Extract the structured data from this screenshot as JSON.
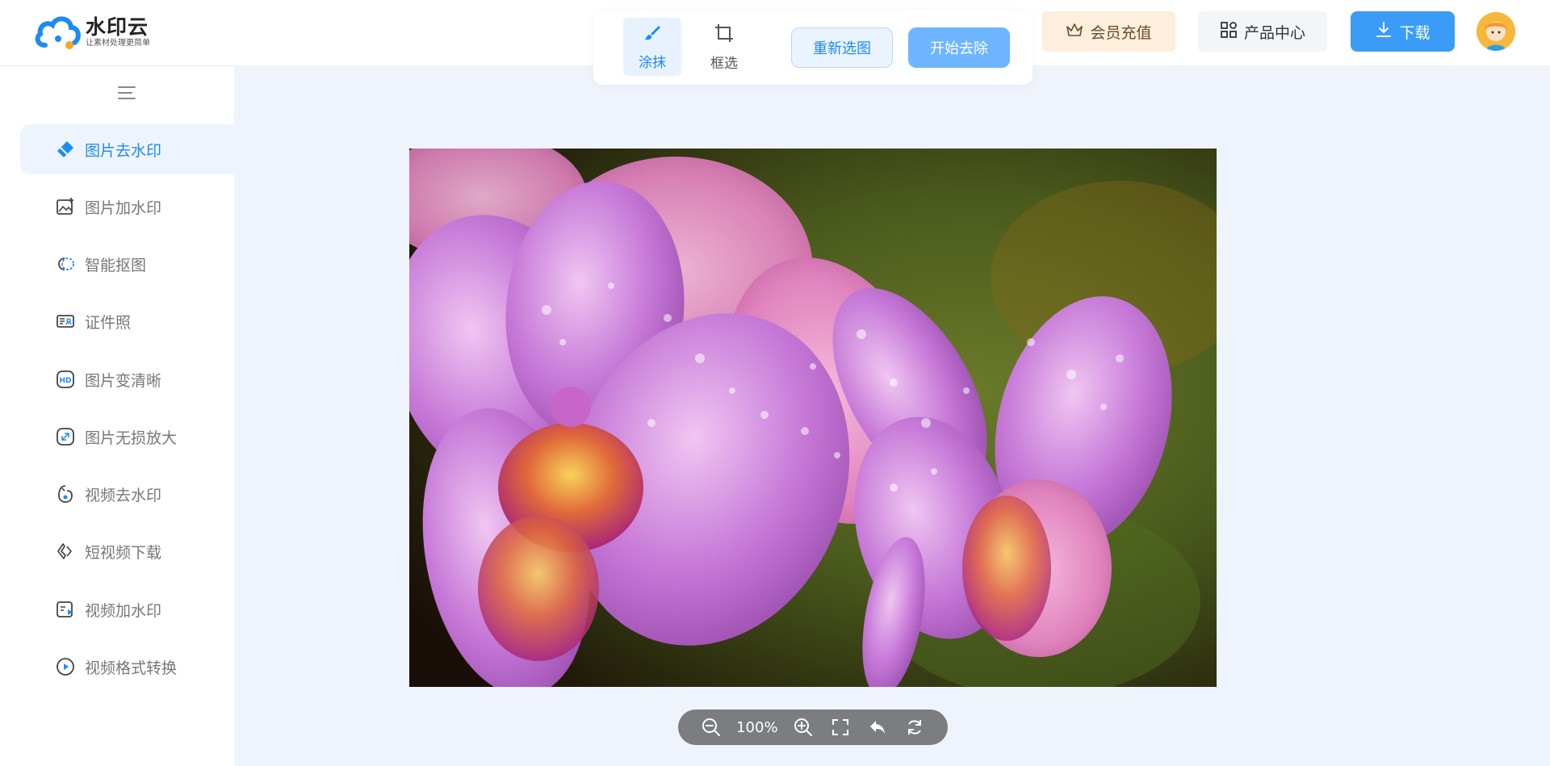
{
  "header": {
    "logo_title": "水印云",
    "logo_subtitle": "让素材处理更简单",
    "tools": [
      {
        "label": "涂抹",
        "icon": "brush-icon",
        "active": true
      },
      {
        "label": "框选",
        "icon": "crop-icon",
        "active": false
      }
    ],
    "reselect_label": "重新选图",
    "start_label": "开始去除",
    "vip_label": "会员充值",
    "product_label": "产品中心",
    "download_label": "下载"
  },
  "sidebar": {
    "items": [
      {
        "label": "图片去水印",
        "icon": "eraser-icon",
        "active": true
      },
      {
        "label": "图片加水印",
        "icon": "image-add-icon",
        "active": false
      },
      {
        "label": "智能抠图",
        "icon": "cutout-icon",
        "active": false
      },
      {
        "label": "证件照",
        "icon": "id-card-icon",
        "active": false
      },
      {
        "label": "图片变清晰",
        "icon": "hd-icon",
        "active": false
      },
      {
        "label": "图片无损放大",
        "icon": "enlarge-icon",
        "active": false
      },
      {
        "label": "视频去水印",
        "icon": "video-eraser-icon",
        "active": false
      },
      {
        "label": "短视频下载",
        "icon": "link-icon",
        "active": false
      },
      {
        "label": "视频加水印",
        "icon": "video-add-icon",
        "active": false
      },
      {
        "label": "视频格式转换",
        "icon": "play-circle-icon",
        "active": false
      }
    ]
  },
  "canvas": {
    "zoom": "100%"
  },
  "colors": {
    "accent": "#1d8bf5",
    "start_button": "#6db5ff",
    "download_button": "#3a9cf7",
    "vip_bg": "#fdeedd",
    "workspace_bg": "#eff3fb"
  }
}
